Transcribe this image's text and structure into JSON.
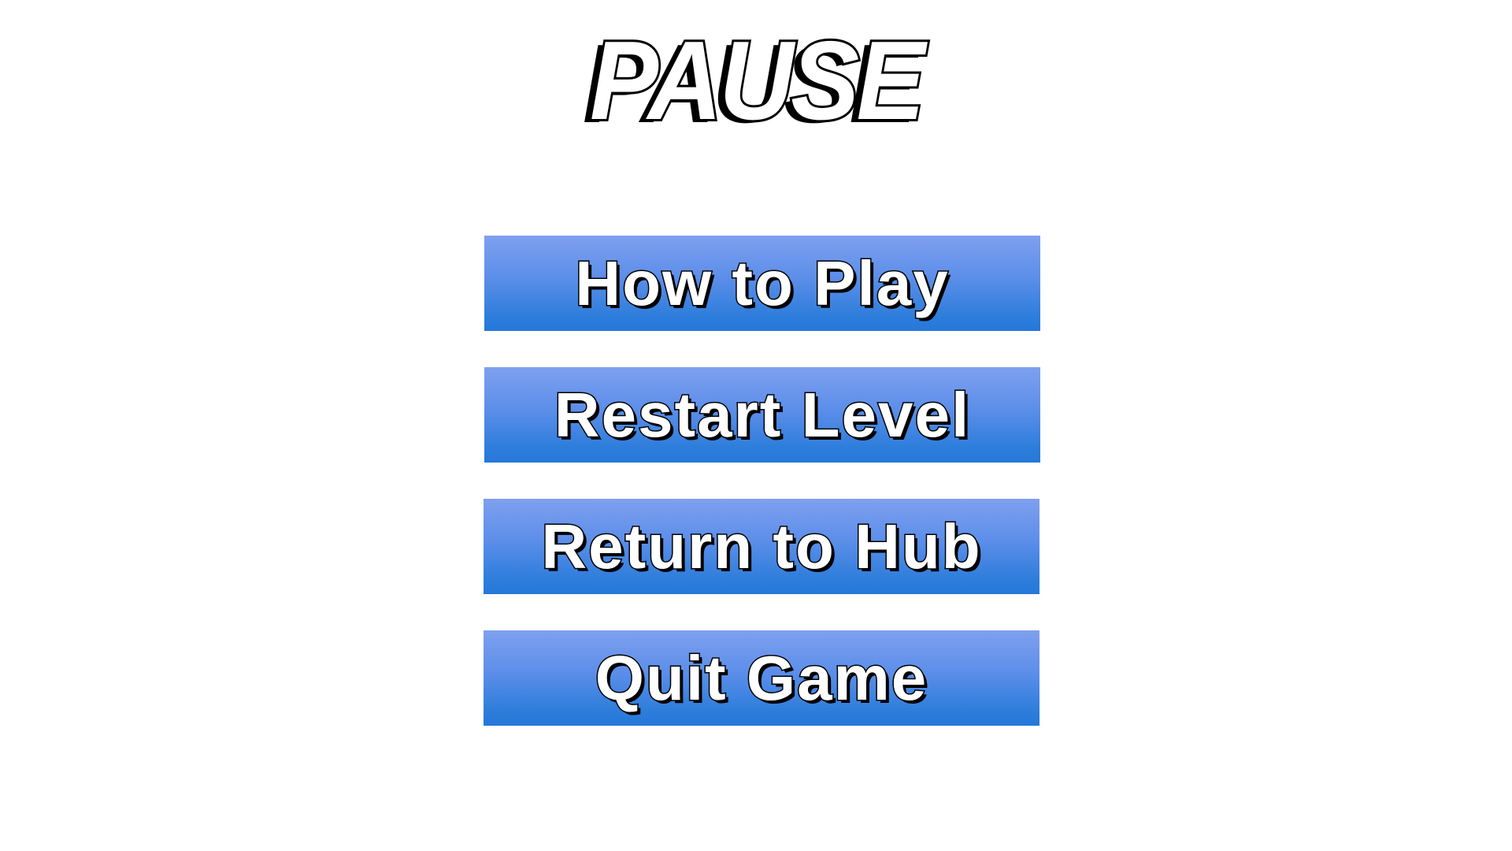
{
  "title": "PAUSE",
  "menu": {
    "items": [
      {
        "id": "how-to-play",
        "label": "How to Play"
      },
      {
        "id": "restart-level",
        "label": "Restart Level"
      },
      {
        "id": "return-to-hub",
        "label": "Return to Hub"
      },
      {
        "id": "quit-game",
        "label": "Quit Game"
      }
    ]
  },
  "colors": {
    "background": "#ffffff",
    "button_gradient_top": "#7fa0ef",
    "button_gradient_bottom": "#2578da",
    "text_fill": "#ffffff",
    "text_outline": "#000000"
  }
}
